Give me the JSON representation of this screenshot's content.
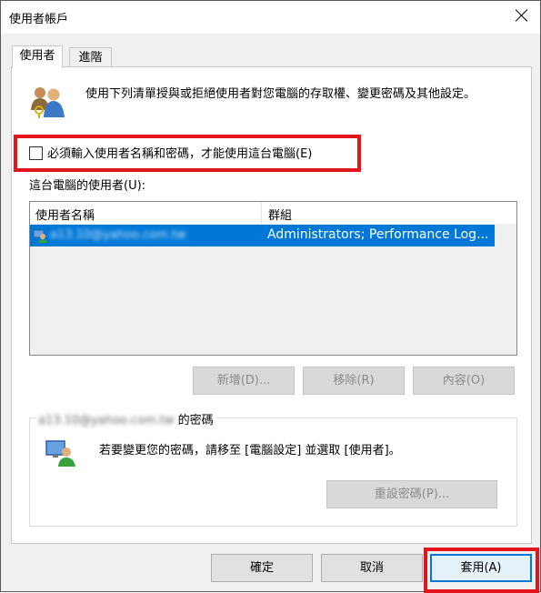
{
  "window": {
    "title": "使用者帳戶"
  },
  "tabs": [
    {
      "label": "使用者"
    },
    {
      "label": "進階"
    }
  ],
  "intro": {
    "text": "使用下列清單授與或拒絕使用者對您電腦的存取權、變更密碼及其他設定。"
  },
  "require_login": {
    "label": "必須輸入使用者名稱和密碼，才能使用這台電腦(E)",
    "checked": false
  },
  "users": {
    "label": "這台電腦的使用者(U):",
    "columns": [
      "使用者名稱",
      "群組"
    ],
    "rows": [
      {
        "name": "a13.10@yahoo.com.tw",
        "groups": "Administrators; Performance Log..."
      }
    ]
  },
  "user_buttons": {
    "add": "新增(D)...",
    "remove": "移除(R)",
    "properties": "內容(O)"
  },
  "password_group": {
    "user": "a13.10@yahoo.com.tw",
    "suffix": "的密碼",
    "text": "若要變更您的密碼，請移至 [電腦設定] 並選取 [使用者]。",
    "reset_button": "重設密碼(P)..."
  },
  "footer": {
    "ok": "確定",
    "cancel": "取消",
    "apply": "套用(A)"
  },
  "colors": {
    "highlight": "#e3141c",
    "selection": "#0078d7"
  }
}
